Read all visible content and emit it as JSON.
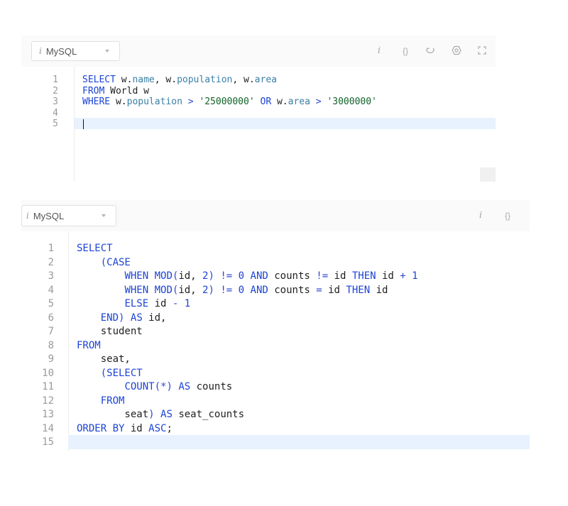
{
  "editor1": {
    "language_label": "MySQL",
    "info_glyph": "i",
    "toolbar_icons": [
      "info-icon",
      "format-braces-icon",
      "reset-icon",
      "settings-icon",
      "fullscreen-icon"
    ],
    "lines": [
      {
        "n": "1",
        "tokens": [
          [
            "kw",
            "SELECT"
          ],
          [
            "t",
            " w."
          ],
          [
            "fld",
            "name"
          ],
          [
            "t",
            ", w."
          ],
          [
            "fld",
            "population"
          ],
          [
            "t",
            ", w."
          ],
          [
            "fld",
            "area"
          ]
        ]
      },
      {
        "n": "2",
        "tokens": [
          [
            "kw",
            "FROM"
          ],
          [
            "t",
            " World w"
          ]
        ]
      },
      {
        "n": "3",
        "tokens": [
          [
            "kw",
            "WHERE"
          ],
          [
            "t",
            " w."
          ],
          [
            "fld",
            "population"
          ],
          [
            "t",
            " "
          ],
          [
            "op",
            ">"
          ],
          [
            "t",
            " "
          ],
          [
            "str",
            "'25000000'"
          ],
          [
            "t",
            " "
          ],
          [
            "kw",
            "OR"
          ],
          [
            "t",
            " w."
          ],
          [
            "fld",
            "area"
          ],
          [
            "t",
            " "
          ],
          [
            "op",
            ">"
          ],
          [
            "t",
            " "
          ],
          [
            "str",
            "'3000000'"
          ]
        ]
      },
      {
        "n": "4",
        "tokens": []
      },
      {
        "n": "5",
        "tokens": []
      }
    ],
    "active_line": 5
  },
  "editor2": {
    "language_label": "MySQL",
    "info_glyph": "i",
    "braces_glyph": "{}",
    "toolbar_icons": [
      "info-icon",
      "format-braces-icon"
    ],
    "lines": [
      {
        "n": "1",
        "tokens": [
          [
            "kw",
            "SELECT"
          ]
        ]
      },
      {
        "n": "2",
        "tokens": [
          [
            "t",
            "    "
          ],
          [
            "kw",
            "(CASE"
          ]
        ]
      },
      {
        "n": "3",
        "tokens": [
          [
            "t",
            "        "
          ],
          [
            "kw",
            "WHEN"
          ],
          [
            "t",
            " "
          ],
          [
            "kw",
            "MOD"
          ],
          [
            "op",
            "("
          ],
          [
            "t",
            "id, "
          ],
          [
            "num",
            "2"
          ],
          [
            "op",
            ")"
          ],
          [
            "t",
            " "
          ],
          [
            "op",
            "!="
          ],
          [
            "t",
            " "
          ],
          [
            "num",
            "0"
          ],
          [
            "t",
            " "
          ],
          [
            "kw",
            "AND"
          ],
          [
            "t",
            " counts "
          ],
          [
            "op",
            "!="
          ],
          [
            "t",
            " id "
          ],
          [
            "kw",
            "THEN"
          ],
          [
            "t",
            " id "
          ],
          [
            "op",
            "+"
          ],
          [
            "t",
            " "
          ],
          [
            "num",
            "1"
          ]
        ]
      },
      {
        "n": "4",
        "tokens": [
          [
            "t",
            "        "
          ],
          [
            "kw",
            "WHEN"
          ],
          [
            "t",
            " "
          ],
          [
            "kw",
            "MOD"
          ],
          [
            "op",
            "("
          ],
          [
            "t",
            "id, "
          ],
          [
            "num",
            "2"
          ],
          [
            "op",
            ")"
          ],
          [
            "t",
            " "
          ],
          [
            "op",
            "!="
          ],
          [
            "t",
            " "
          ],
          [
            "num",
            "0"
          ],
          [
            "t",
            " "
          ],
          [
            "kw",
            "AND"
          ],
          [
            "t",
            " counts "
          ],
          [
            "op",
            "="
          ],
          [
            "t",
            " id "
          ],
          [
            "kw",
            "THEN"
          ],
          [
            "t",
            " id"
          ]
        ]
      },
      {
        "n": "5",
        "tokens": [
          [
            "t",
            "        "
          ],
          [
            "kw",
            "ELSE"
          ],
          [
            "t",
            " id "
          ],
          [
            "op",
            "-"
          ],
          [
            "t",
            " "
          ],
          [
            "num",
            "1"
          ]
        ]
      },
      {
        "n": "6",
        "tokens": [
          [
            "t",
            "    "
          ],
          [
            "kw",
            "END"
          ],
          [
            "op",
            ")"
          ],
          [
            "t",
            " "
          ],
          [
            "kw",
            "AS"
          ],
          [
            "t",
            " id,"
          ]
        ]
      },
      {
        "n": "7",
        "tokens": [
          [
            "t",
            "    student"
          ]
        ]
      },
      {
        "n": "8",
        "tokens": [
          [
            "kw",
            "FROM"
          ]
        ]
      },
      {
        "n": "9",
        "tokens": [
          [
            "t",
            "    seat,"
          ]
        ]
      },
      {
        "n": "10",
        "tokens": [
          [
            "t",
            "    "
          ],
          [
            "kw",
            "(SELECT"
          ]
        ]
      },
      {
        "n": "11",
        "tokens": [
          [
            "t",
            "        "
          ],
          [
            "kw",
            "COUNT"
          ],
          [
            "op",
            "(*)"
          ],
          [
            "t",
            " "
          ],
          [
            "kw",
            "AS"
          ],
          [
            "t",
            " counts"
          ]
        ]
      },
      {
        "n": "12",
        "tokens": [
          [
            "t",
            "    "
          ],
          [
            "kw",
            "FROM"
          ]
        ]
      },
      {
        "n": "13",
        "tokens": [
          [
            "t",
            "        seat"
          ],
          [
            "op",
            ")"
          ],
          [
            "t",
            " "
          ],
          [
            "kw",
            "AS"
          ],
          [
            "t",
            " seat_counts"
          ]
        ]
      },
      {
        "n": "14",
        "tokens": [
          [
            "kw",
            "ORDER BY"
          ],
          [
            "t",
            " id "
          ],
          [
            "kw",
            "ASC"
          ],
          [
            "t",
            ";"
          ]
        ]
      },
      {
        "n": "15",
        "tokens": []
      }
    ],
    "active_line": 15
  },
  "colors": {
    "keyword": "#1c43d6",
    "field": "#3a7fa5",
    "string": "#116329",
    "active_line_bg": "#e8f2ff",
    "line_number": "#9a9a9a"
  }
}
